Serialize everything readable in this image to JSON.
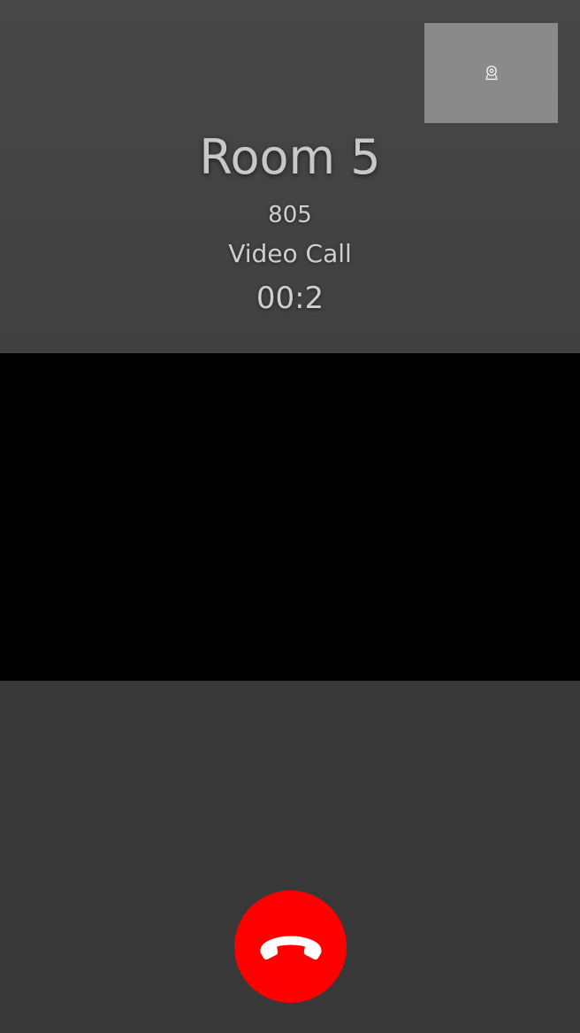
{
  "call": {
    "caller_name": "Room 5",
    "caller_number": "805",
    "call_type": "Video Call",
    "timer": "00:2"
  },
  "controls": {
    "hangup_icon": "phone-hangup-icon",
    "self_view_icon": "webcam-icon"
  },
  "colors": {
    "hangup": "#ff0000",
    "remote_video": "#000000",
    "self_view": "#8a8a8a",
    "background": "#383838"
  }
}
